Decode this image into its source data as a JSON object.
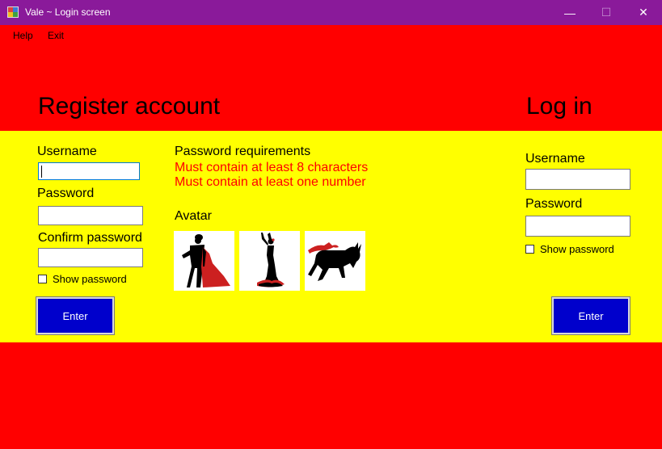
{
  "window": {
    "title": "Vale ~ Login screen",
    "minimize_glyph": "—",
    "maximize_glyph": "☐",
    "close_glyph": "✕"
  },
  "menu": {
    "items": [
      {
        "label": "Help"
      },
      {
        "label": "Exit"
      }
    ]
  },
  "register": {
    "heading": "Register account",
    "username_label": "Username",
    "password_label": "Password",
    "confirm_label": "Confirm password",
    "show_password_label": "Show password",
    "enter_label": "Enter"
  },
  "requirements": {
    "heading": "Password requirements",
    "items": [
      "Must contain at least 8 characters",
      "Must contain at least one number"
    ]
  },
  "avatar": {
    "label": "Avatar",
    "options": [
      {
        "icon": "matador-icon"
      },
      {
        "icon": "flamenco-dancer-icon"
      },
      {
        "icon": "bull-icon"
      }
    ]
  },
  "login": {
    "heading": "Log in",
    "username_label": "Username",
    "password_label": "Password",
    "show_password_label": "Show password",
    "enter_label": "Enter"
  },
  "colors": {
    "titlebar": "#8a1a9a",
    "flag_red": "#ff0000",
    "flag_yellow": "#ffff00",
    "button_blue": "#0000cc",
    "requirement_text": "#ff0000"
  }
}
